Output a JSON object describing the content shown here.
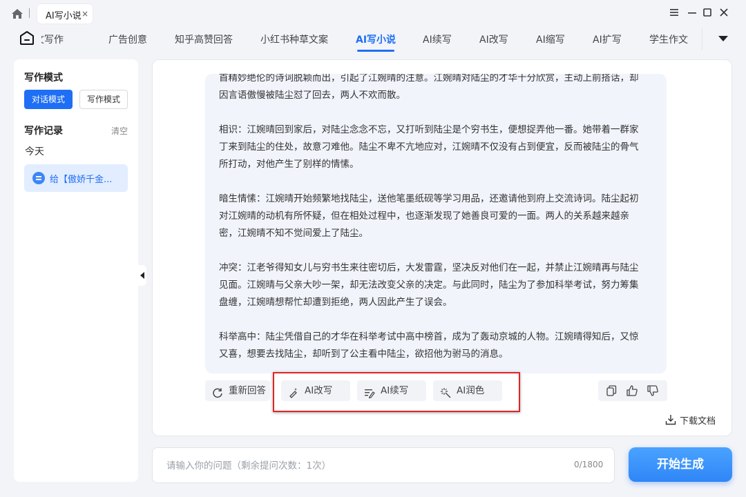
{
  "titlebar": {
    "tab_title": "AI写小说",
    "tab_close": "×"
  },
  "nav": {
    "items": [
      "长文写作",
      "广告创意",
      "知乎高赞回答",
      "小红书种草文案",
      "AI写小说",
      "AI续写",
      "AI改写",
      "AI缩写",
      "AI扩写",
      "学生作文"
    ],
    "active_index": 4
  },
  "sidebar": {
    "mode_title": "写作模式",
    "mode_chat": "对话模式",
    "mode_write": "写作模式",
    "records_title": "写作记录",
    "clear_label": "清空",
    "today_label": "今天",
    "history_item": "给【傲娇千金..."
  },
  "answer": {
    "paragraphs": [
      "首精妙绝伦的诗词脱颖而出，引起了江婉晴的注意。江婉晴对陆尘的才华十分欣赏，主动上前搭话，却因言语傲慢被陆尘怼了回去，两人不欢而散。",
      "相识：江婉晴回到家后，对陆尘念念不忘，又打听到陆尘是个穷书生，便想捉弄他一番。她带着一群家丁来到陆尘的住处，故意刁难他。陆尘不卑不亢地应对，江婉晴不仅没有占到便宜，反而被陆尘的骨气所打动，对他产生了别样的情愫。",
      "暗生情愫：江婉晴开始频繁地找陆尘，送他笔墨纸砚等学习用品，还邀请他到府上交流诗词。陆尘起初对江婉晴的动机有所怀疑，但在相处过程中，也逐渐发现了她善良可爱的一面。两人的关系越来越亲密，江婉晴不知不觉间爱上了陆尘。",
      "冲突：江老爷得知女儿与穷书生来往密切后，大发雷霆，坚决反对他们在一起，并禁止江婉晴再与陆尘见面。江婉晴与父亲大吵一架，却无法改变父亲的决定。与此同时，陆尘为了参加科举考试，努力筹集盘缠，江婉晴想帮忙却遭到拒绝，两人因此产生了误会。",
      "科举高中：陆尘凭借自己的才华在科举考试中高中榜首，成为了轰动京城的人物。江婉晴得知后，又惊又喜，想要去找陆尘，却听到了公主看中陆尘，欲招他为驸马的消息。"
    ]
  },
  "actions": {
    "regen": "重新回答",
    "rewrite": "AI改写",
    "continue": "AI续写",
    "polish": "AI润色",
    "download": "下载文档"
  },
  "input": {
    "placeholder": "请输入你的问题（剩余提问次数：1次）",
    "value": "",
    "count": "0/1800"
  },
  "generate_label": "开始生成",
  "colors": {
    "accent": "#1e6ff5",
    "highlight": "#e02424",
    "answer_bg": "#f1f4fb"
  }
}
